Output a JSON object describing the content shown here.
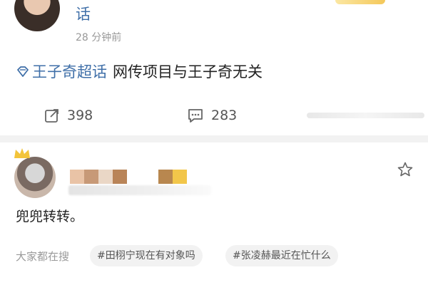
{
  "post": {
    "topic_tail": "话",
    "time": "28 分钟前",
    "content_topic": "王子奇超话",
    "content_text": "网传项目与王子奇无关",
    "repost_count": "398",
    "comment_count": "283"
  },
  "comment": {
    "text": "兜兜转转。"
  },
  "search": {
    "label": "大家都在搜",
    "tags": [
      "#田栩宁现在有对象吗",
      "#张凌赫最近在忙什么"
    ]
  },
  "colors": {
    "link": "#3f6fa8",
    "muted": "#999999",
    "separator": "#f2f2f2"
  },
  "icons": [
    "diamond-icon",
    "repost-icon",
    "comment-icon",
    "star-icon",
    "crown-icon"
  ]
}
